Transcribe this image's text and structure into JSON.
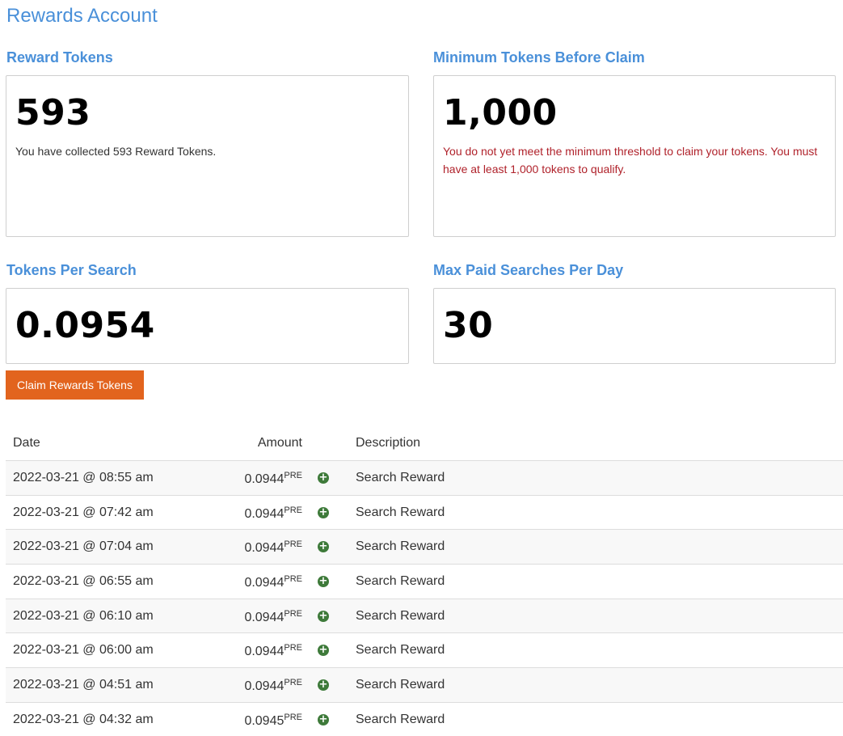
{
  "page": {
    "title": "Rewards Account"
  },
  "reward_tokens": {
    "label": "Reward Tokens",
    "value": "593",
    "note": "You have collected 593 Reward Tokens."
  },
  "minimum_tokens": {
    "label": "Minimum Tokens Before Claim",
    "value": "1,000",
    "note": "You do not yet meet the minimum threshold to claim your tokens. You must have at least 1,000 tokens to qualify."
  },
  "tokens_per_search": {
    "label": "Tokens Per Search",
    "value": "0.0954"
  },
  "max_paid_searches": {
    "label": "Max Paid Searches Per Day",
    "value": "30"
  },
  "claim_button": {
    "label": "Claim Rewards Tokens"
  },
  "table": {
    "headers": {
      "date": "Date",
      "amount": "Amount",
      "description": "Description"
    },
    "rows": [
      {
        "date": "2022-03-21 @ 08:55 am",
        "amount": "0.0944",
        "unit": "PRE",
        "description": "Search Reward"
      },
      {
        "date": "2022-03-21 @ 07:42 am",
        "amount": "0.0944",
        "unit": "PRE",
        "description": "Search Reward"
      },
      {
        "date": "2022-03-21 @ 07:04 am",
        "amount": "0.0944",
        "unit": "PRE",
        "description": "Search Reward"
      },
      {
        "date": "2022-03-21 @ 06:55 am",
        "amount": "0.0944",
        "unit": "PRE",
        "description": "Search Reward"
      },
      {
        "date": "2022-03-21 @ 06:10 am",
        "amount": "0.0944",
        "unit": "PRE",
        "description": "Search Reward"
      },
      {
        "date": "2022-03-21 @ 06:00 am",
        "amount": "0.0944",
        "unit": "PRE",
        "description": "Search Reward"
      },
      {
        "date": "2022-03-21 @ 04:51 am",
        "amount": "0.0944",
        "unit": "PRE",
        "description": "Search Reward"
      },
      {
        "date": "2022-03-21 @ 04:32 am",
        "amount": "0.0945",
        "unit": "PRE",
        "description": "Search Reward"
      }
    ]
  },
  "icons": {
    "row_icon": "plus-circle-icon"
  },
  "colors": {
    "accent": "#4a90d9",
    "button": "#e2641e",
    "warning": "#b0222b",
    "icon": "#3e7a3a"
  }
}
